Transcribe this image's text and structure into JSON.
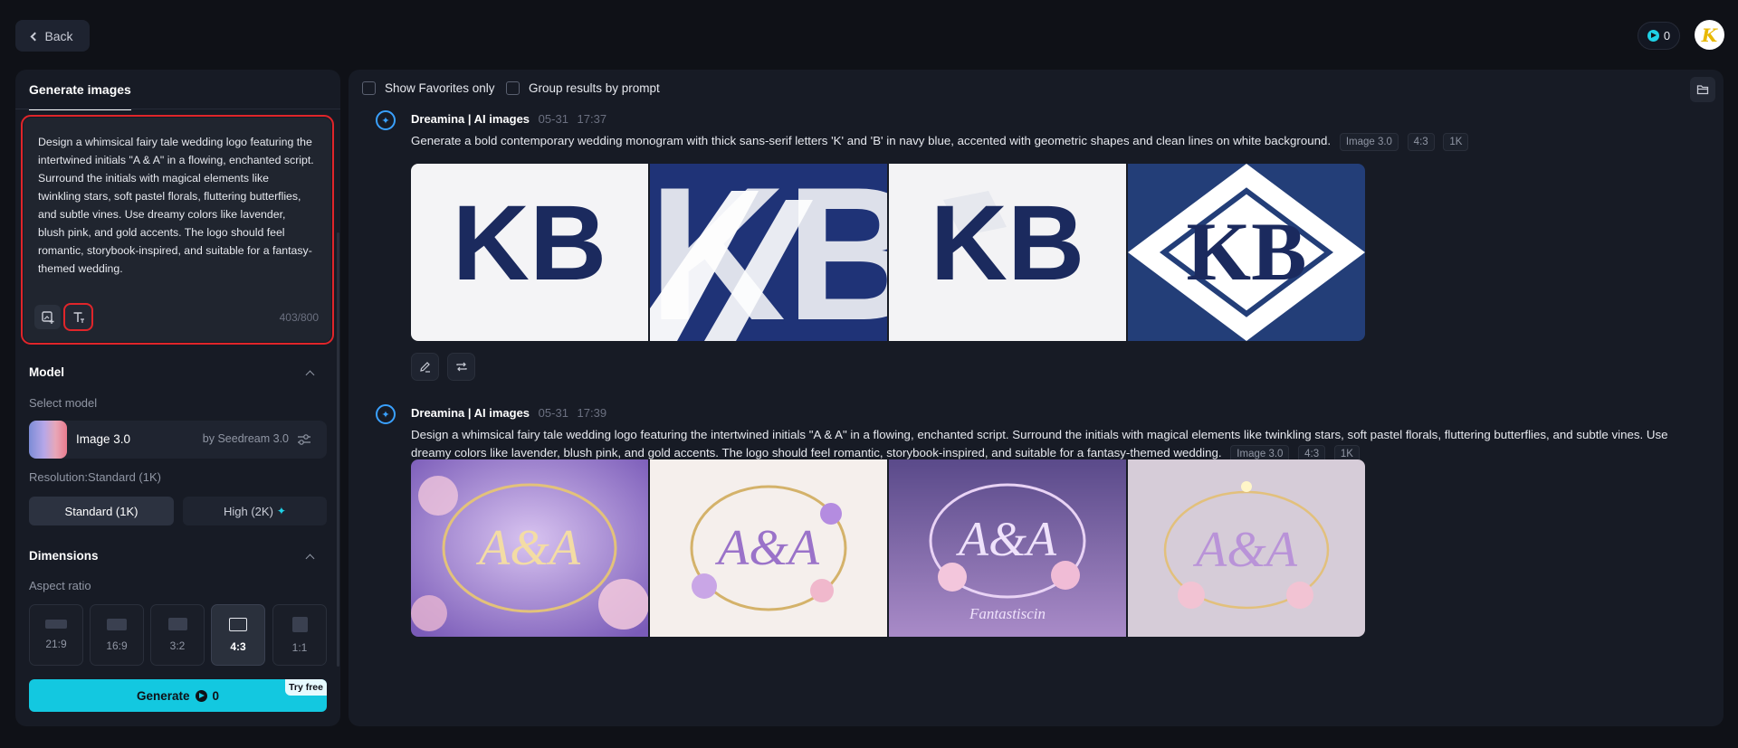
{
  "header": {
    "back_label": "Back",
    "credits": "0",
    "avatar_letter": "K"
  },
  "left_panel": {
    "tab_label": "Generate images",
    "prompt_text": "Design a whimsical fairy tale wedding logo featuring the intertwined initials \"A & A\" in a flowing, enchanted script. Surround the initials with magical elements like twinkling stars, soft pastel florals, fluttering butterflies, and subtle vines. Use dreamy colors like lavender, blush pink, and gold accents. The logo should feel romantic, storybook-inspired, and suitable for a fantasy-themed wedding.",
    "char_count": "403/800",
    "model_section": {
      "title": "Model",
      "select_label": "Select model",
      "model_name": "Image 3.0",
      "model_by": "by Seedream 3.0"
    },
    "resolution": {
      "label": "Resolution:Standard (1K)",
      "standard_label": "Standard (1K)",
      "high_label": "High (2K)"
    },
    "dimensions": {
      "title": "Dimensions",
      "aspect_label": "Aspect ratio",
      "ratios": [
        "21:9",
        "16:9",
        "3:2",
        "4:3",
        "1:1"
      ],
      "selected": "4:3"
    },
    "generate": {
      "label": "Generate",
      "cost": "0",
      "badge": "Try free"
    }
  },
  "right_panel": {
    "filters": {
      "favorites_label": "Show Favorites only",
      "group_label": "Group results by prompt"
    },
    "results": [
      {
        "source": "Dreamina | AI images",
        "date": "05-31",
        "time": "17:37",
        "prompt": "Generate a bold contemporary wedding monogram with thick sans-serif letters 'K' and 'B' in navy blue, accented with geometric shapes and clean lines on white background.",
        "tags": [
          "Image 3.0",
          "4:3",
          "1K"
        ]
      },
      {
        "source": "Dreamina | AI images",
        "date": "05-31",
        "time": "17:39",
        "prompt": "Design a whimsical fairy tale wedding logo featuring the intertwined initials \"A & A\" in a flowing, enchanted script. Surround the initials with magical elements like twinkling stars, soft pastel florals, fluttering butterflies, and subtle vines. Use dreamy colors like lavender, blush pink, and gold accents. The logo should feel romantic, storybook-inspired, and suitable for a fantasy-themed wedding.",
        "tags": [
          "Image 3.0",
          "4:3",
          "1K"
        ],
        "image3_caption": "Fantastiscin"
      }
    ],
    "image_text": {
      "kb_monogram": "KB",
      "aa_monogram": "A&A"
    }
  },
  "colors": {
    "accent": "#13c8e0",
    "highlight": "#e0252a",
    "navy": "#1b2a5e",
    "background": "#0f1117",
    "panel": "#171b25"
  }
}
